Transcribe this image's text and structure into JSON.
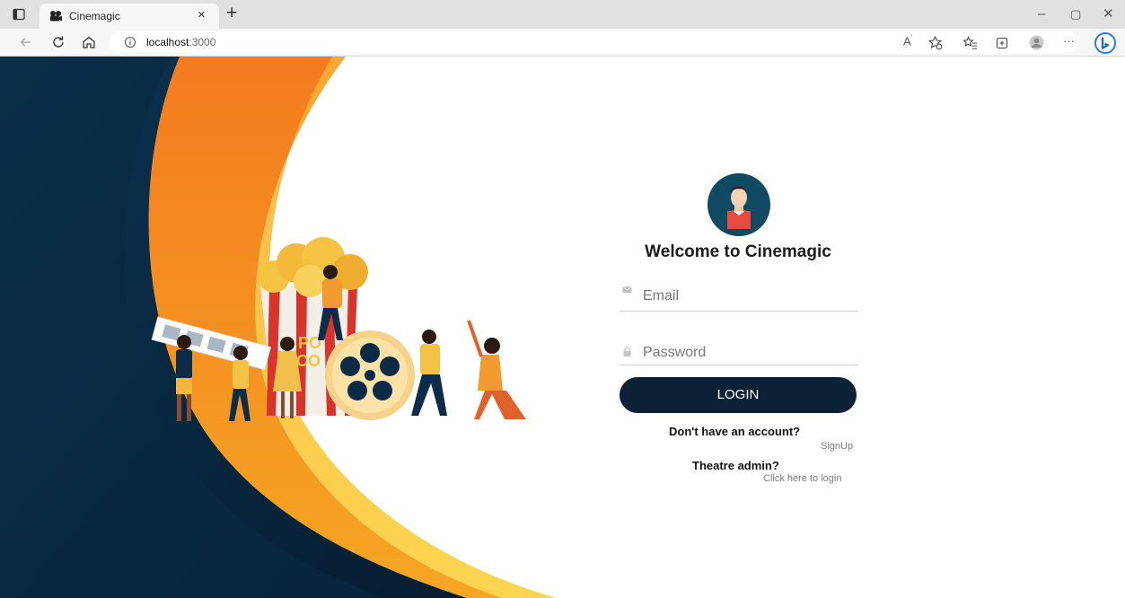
{
  "browser": {
    "tab_title": "Cinemagic",
    "url_host": "localhost",
    "url_port": ":3000",
    "read_aloud_label": "A̅"
  },
  "login": {
    "heading": "Welcome to Cinemagic",
    "email_placeholder": "Email",
    "password_placeholder": "Password",
    "login_button": "LOGIN",
    "no_account_prompt": "Don't have an account?",
    "signup_link": "SignUp",
    "admin_prompt": "Theatre admin?",
    "admin_link": "Click here to login"
  },
  "illustration": {
    "popcorn_text_1": "PO",
    "popcorn_text_2": "CO"
  },
  "colors": {
    "navy": "#0a2a44",
    "orange": "#f39a2a",
    "yellow": "#f7c23a",
    "button": "#0c2135",
    "avatar_bg": "#0f4a62"
  }
}
